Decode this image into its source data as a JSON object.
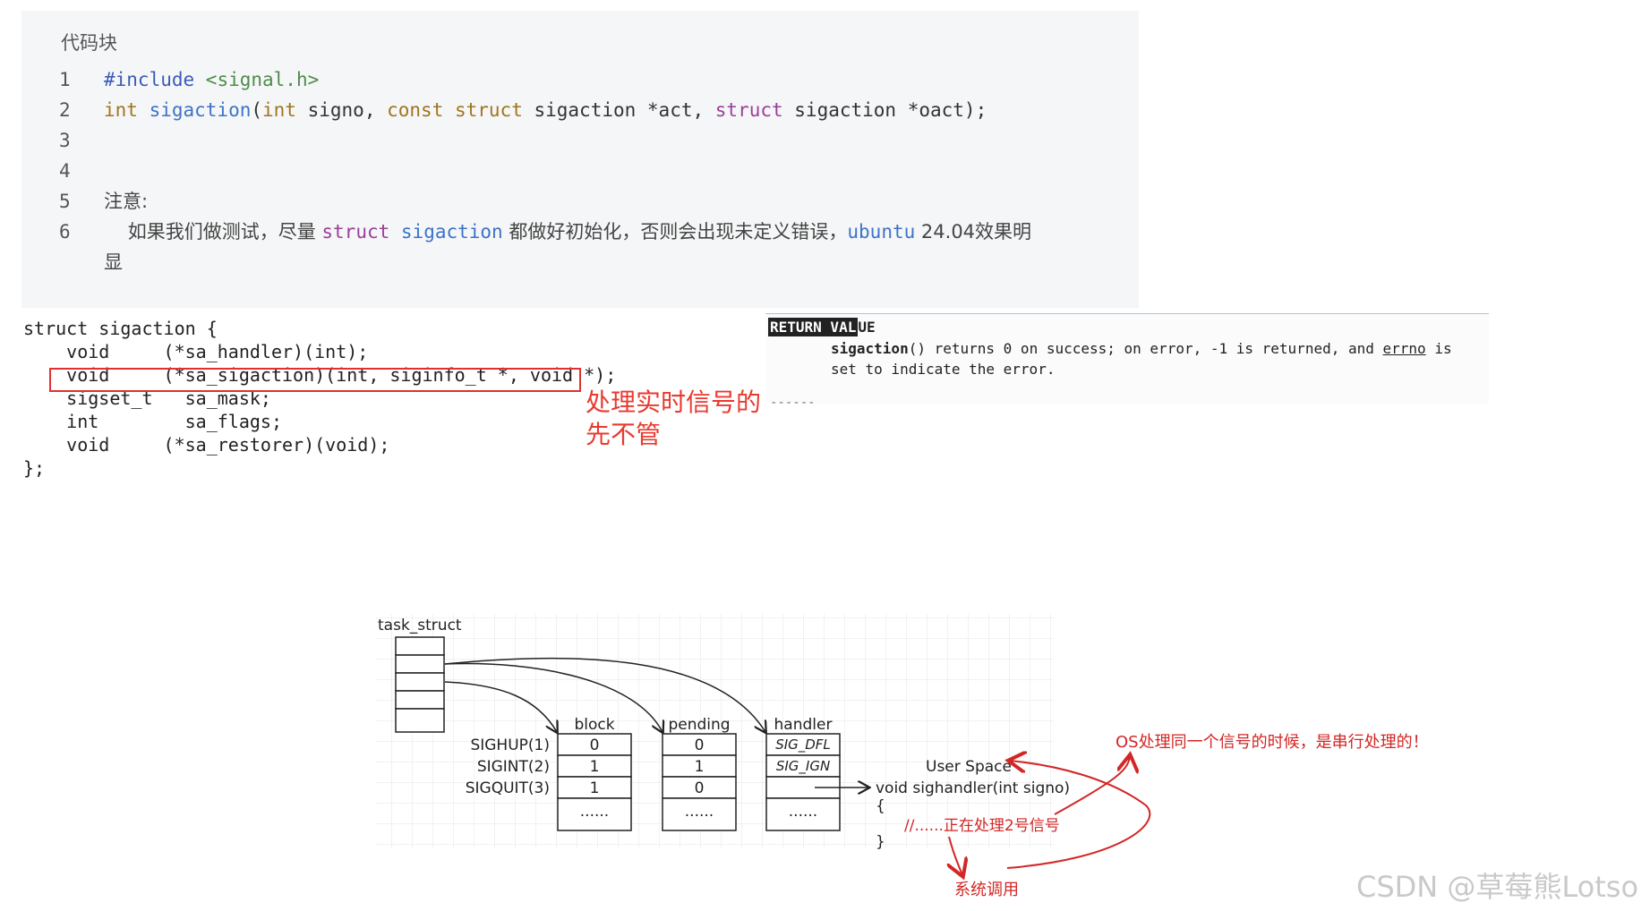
{
  "code_block": {
    "header": "代码块",
    "lines": [
      {
        "num": "1",
        "parts": [
          {
            "t": "#include ",
            "c": "pp"
          },
          {
            "t": "<signal.h>",
            "c": "inc"
          }
        ]
      },
      {
        "num": "2",
        "parts": [
          {
            "t": "int ",
            "c": "kw"
          },
          {
            "t": "sigaction",
            "c": "fn"
          },
          {
            "t": "(",
            "c": "plain"
          },
          {
            "t": "int",
            "c": "kw"
          },
          {
            "t": " signo, ",
            "c": "plain"
          },
          {
            "t": "const struct",
            "c": "kw"
          },
          {
            "t": " sigaction *act, ",
            "c": "plain"
          },
          {
            "t": "struct",
            "c": "kw2"
          },
          {
            "t": " sigaction *oact);",
            "c": "plain"
          }
        ]
      },
      {
        "num": "3",
        "parts": []
      },
      {
        "num": "4",
        "parts": []
      },
      {
        "num": "5",
        "parts": [
          {
            "t": "注意:",
            "c": "note"
          }
        ]
      },
      {
        "num": "6",
        "parts": [
          {
            "t": "    如果我们做测试，尽量 ",
            "c": "note"
          },
          {
            "t": "struct",
            "c": "kw2"
          },
          {
            "t": " ",
            "c": "plain"
          },
          {
            "t": "sigaction",
            "c": "fn"
          },
          {
            "t": " 都做好初始化，否则会出现未定义错误，",
            "c": "note"
          },
          {
            "t": "ubuntu",
            "c": "fn"
          },
          {
            "t": " 24.04效果明",
            "c": "note"
          }
        ]
      },
      {
        "num": "",
        "parts": [
          {
            "t": "显",
            "c": "note"
          }
        ]
      }
    ]
  },
  "struct_def": {
    "lines": [
      "struct sigaction {",
      "    void     (*sa_handler)(int);",
      "    void     (*sa_sigaction)(int, siginfo_t *, void *);",
      "    sigset_t   sa_mask;",
      "    int        sa_flags;",
      "    void     (*sa_restorer)(void);",
      "};"
    ],
    "note_line1": "处理实时信号的",
    "note_line2": "先不管"
  },
  "return_value": {
    "title_dark": "RETURN VAL",
    "title_rest": "UE",
    "fn_name": "sigaction",
    "line1_rest": "() returns 0 on success; on error, -1 is returned, and ",
    "errno": "errno",
    "line1_end": " is",
    "line2": "set to indicate the error.",
    "dash": "------"
  },
  "diagram": {
    "task_struct": "task_struct",
    "col_block": "block",
    "col_pending": "pending",
    "col_handler": "handler",
    "signals": [
      "SIGHUP(1)",
      "SIGINT(2)",
      "SIGQUIT(3)"
    ],
    "block": [
      "0",
      "1",
      "1",
      "......"
    ],
    "pending": [
      "0",
      "1",
      "0",
      "......"
    ],
    "handler": [
      "SIG_DFL",
      "SIG_IGN",
      "",
      "......"
    ],
    "user_space": "User Space",
    "handler_sig": "void sighandler(int signo)",
    "brace_open": "{",
    "brace_close": "}",
    "comment": "//......正在处理2号信号",
    "syscall": "系统调用",
    "os_note": "OS处理同一个信号的时候，是串行处理的！"
  },
  "watermark": "CSDN @草莓熊Lotso"
}
